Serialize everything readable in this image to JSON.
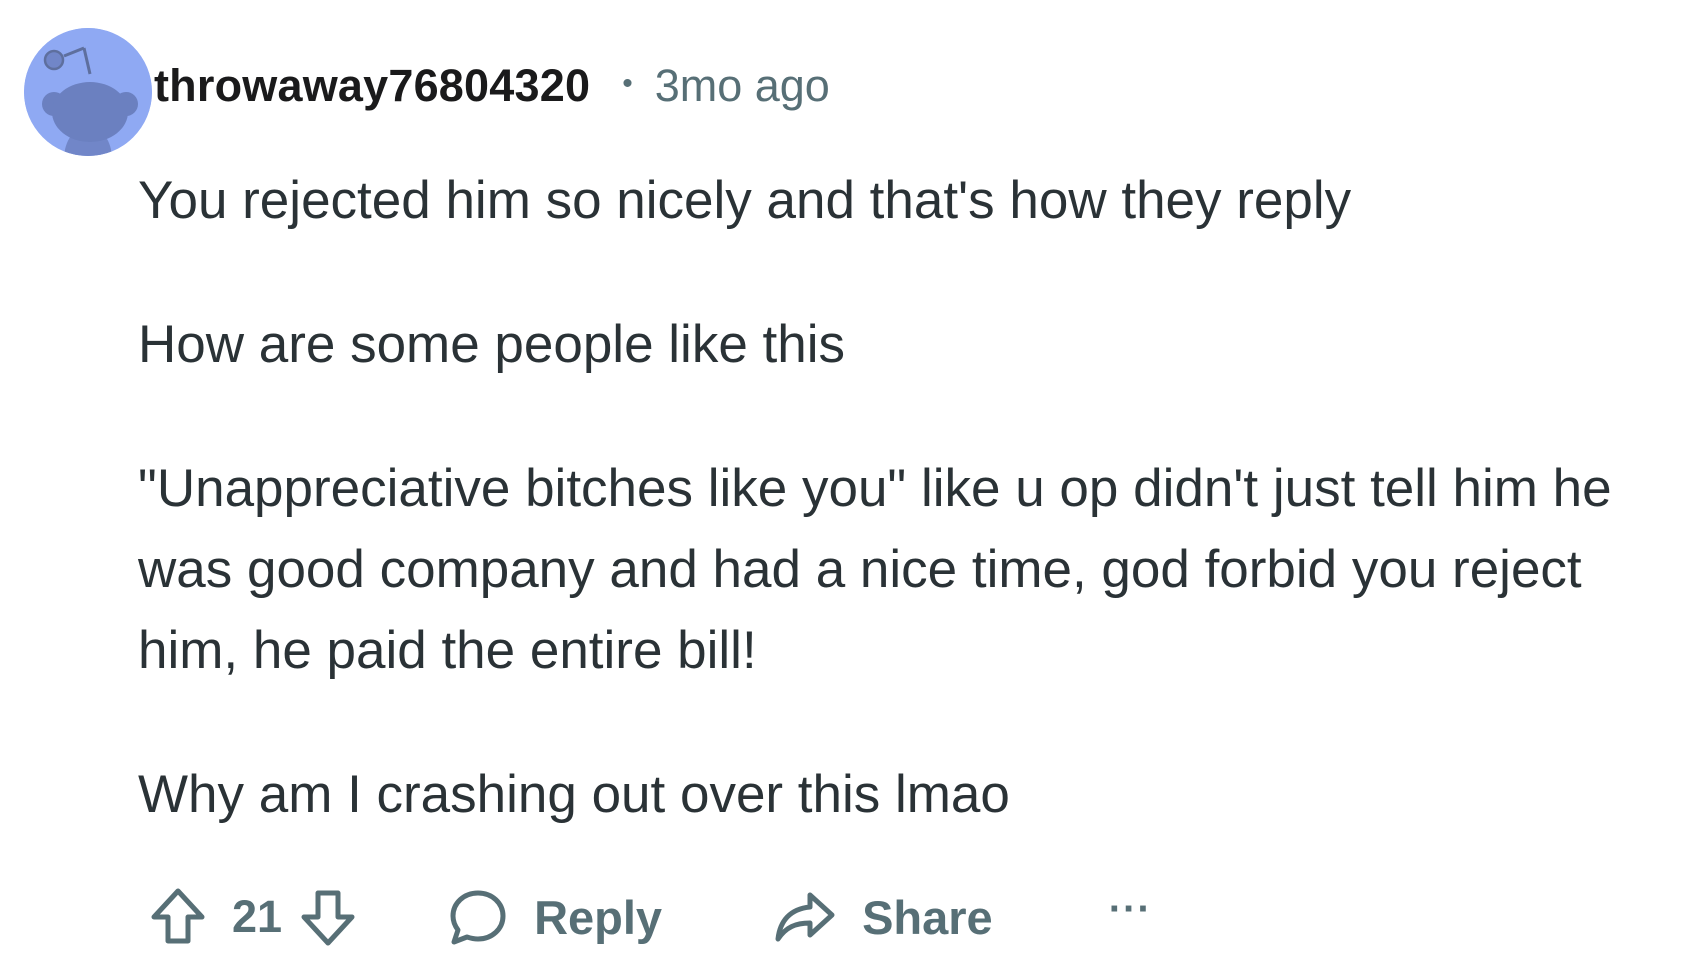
{
  "comment": {
    "username": "throwaway76804320",
    "separator": "•",
    "timestamp": "3mo ago",
    "paragraphs": [
      "You rejected him so nicely and that's how they reply",
      "How are some people like this",
      "\"Unappreciative bitches like you\" like u op didn't just tell him he was good company and had a nice time, god forbid you reject him, he paid the entire bill!",
      "Why am I crashing out over this lmao"
    ],
    "score": "21",
    "reply_label": "Reply",
    "share_label": "Share",
    "more_label": "···"
  },
  "icons": {
    "avatar": "reddit-snoo-avatar",
    "upvote": "arrow-up-icon",
    "downvote": "arrow-down-icon",
    "reply": "speech-bubble-icon",
    "share": "share-arrow-icon",
    "more": "ellipsis-icon"
  },
  "colors": {
    "avatar_bg": "#8fa9f3",
    "text": "#2a3236",
    "meta": "#576f76",
    "username": "#1a1a1b"
  }
}
